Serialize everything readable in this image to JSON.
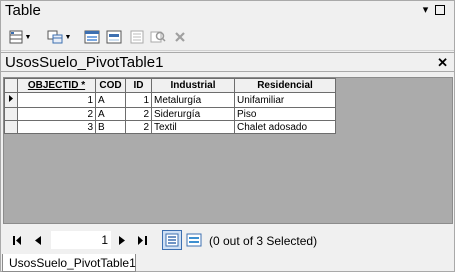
{
  "window": {
    "title": "Table"
  },
  "toolbar": {
    "icons": [
      "table-options-icon",
      "related-tables-icon",
      "select-by-attributes-icon",
      "switch-selection-icon",
      "clear-selection-icon",
      "zoom-to-selected-icon",
      "delete-selected-icon"
    ]
  },
  "tab": {
    "title": "UsosSuelo_PivotTable1"
  },
  "table": {
    "columns": [
      "OBJECTID *",
      "COD",
      "ID",
      "Industrial",
      "Residencial"
    ],
    "rows": [
      {
        "objectid": "1",
        "cod": "A",
        "id": "1",
        "industrial": "Metalurgía",
        "residencial": "Unifamiliar"
      },
      {
        "objectid": "2",
        "cod": "A",
        "id": "2",
        "industrial": "Siderurgía",
        "residencial": "Piso"
      },
      {
        "objectid": "3",
        "cod": "B",
        "id": "2",
        "industrial": "Textil",
        "residencial": "Chalet adosado"
      }
    ]
  },
  "navigation": {
    "current_record": "1",
    "selection_status": "(0 out of 3 Selected)"
  },
  "bottom_tab": {
    "label": "UsosSuelo_PivotTable1"
  },
  "colors": {
    "accent": "#3d6fb0",
    "grid_background": "#ababab",
    "header_background": "#f0f0f0"
  }
}
